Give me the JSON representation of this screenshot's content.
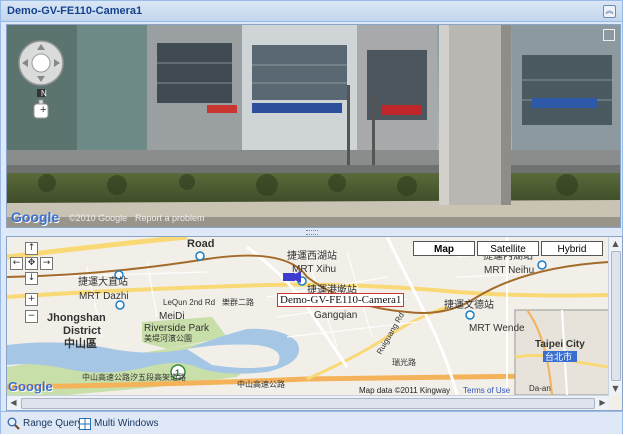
{
  "window": {
    "title": "Demo-GV-FE110-Camera1",
    "collapse_icon": "double-up-chevron-icon"
  },
  "street_view": {
    "logo": "Google",
    "copyright": "©2010 Google",
    "report_link": "Report a problem",
    "compass_letter": "N",
    "zoom_in": "+",
    "fullscreen_icon": "expand-icon"
  },
  "map": {
    "type_buttons": [
      "Map",
      "Satellite",
      "Hybrid"
    ],
    "pan_labels": {
      "up": "↑",
      "left": "←",
      "center": "✥",
      "right": "→",
      "down": "↓",
      "zoom_in": "+",
      "zoom_out": "−"
    },
    "logo": "Google",
    "attribution": "Map data ©2011 Kingway",
    "terms_link": "Terms of Use",
    "camera_label": "Demo-GV-FE110-Camera1",
    "places": {
      "road": "Road",
      "xihu_cn": "捷運西湖站",
      "xihu": "MRT Xihu",
      "gangqian_cn": "捷運港墘站",
      "gangqian": "Gangqian",
      "dazhi_cn": "捷運大直站",
      "dazhi": "MRT Dazhi",
      "neihu_cn": "捷運內湖站",
      "neihu": "MRT Neihu",
      "wende_cn": "捷運文德站",
      "wende": "MRT Wende",
      "lecun": "LeQun 2nd Rd",
      "lecun_cn": "樂群二路",
      "meidi": "MeiDi",
      "riverside": "Riverside Park",
      "riverside_cn": "美堤河濱公園",
      "jhongshan": "Jhongshan",
      "district": "District",
      "zhongshan_cn": "中山區",
      "ruiguang": "Ruiguang Rd",
      "ruiguang_cn": "瑞光路",
      "expressway_cn": "中山高速公路汐五段高架道路",
      "expressway2_cn": "中山高速公路",
      "hwy": "1",
      "taipei": "Taipei City",
      "taipei_cn": "台北市",
      "daan": "Da-an"
    }
  },
  "toolbar": {
    "range_query": "Range Query",
    "multi_windows": "Multi Windows",
    "range_query_icon": "magnifier-icon",
    "multi_windows_icon": "window-grid-icon"
  },
  "colors": {
    "panel_border": "#99bbe8",
    "panel_bg": "#dfe8f6",
    "title_text": "#15428b",
    "river": "#a5c6e5",
    "park": "#c9dfa9",
    "road_major": "#f9d976"
  }
}
